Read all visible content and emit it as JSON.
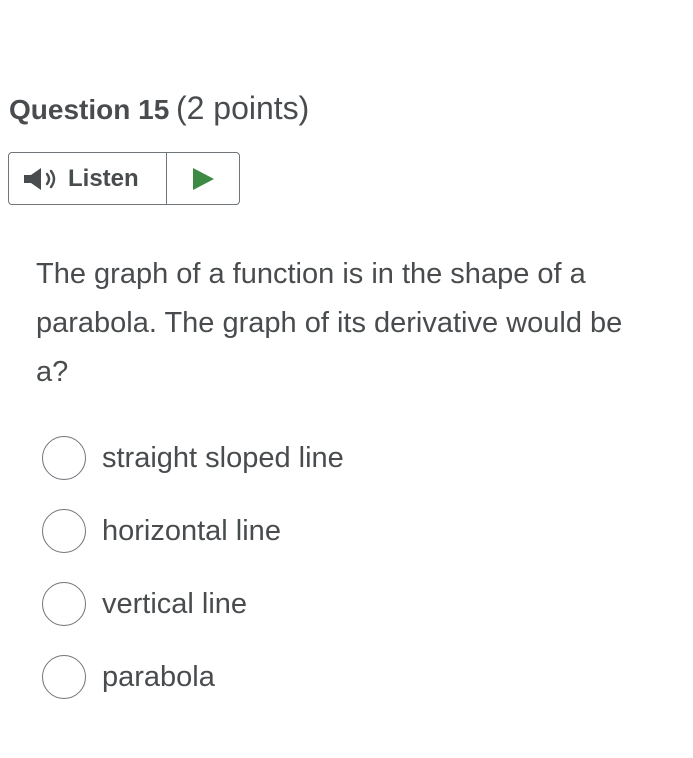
{
  "question": {
    "title": "Question 15",
    "points": "(2 points)",
    "text_lines": [
      "The graph of a function is in the shape of a",
      "parabola.  The graph of its derivative would be",
      "a?"
    ]
  },
  "listen": {
    "label": "Listen",
    "speaker_icon": "speaker-icon",
    "play_icon": "play-icon",
    "play_color": "#3d8a45"
  },
  "options": [
    {
      "label": "straight sloped line",
      "selected": false
    },
    {
      "label": "horizontal line",
      "selected": false
    },
    {
      "label": "vertical line",
      "selected": false
    },
    {
      "label": "parabola",
      "selected": false
    }
  ]
}
